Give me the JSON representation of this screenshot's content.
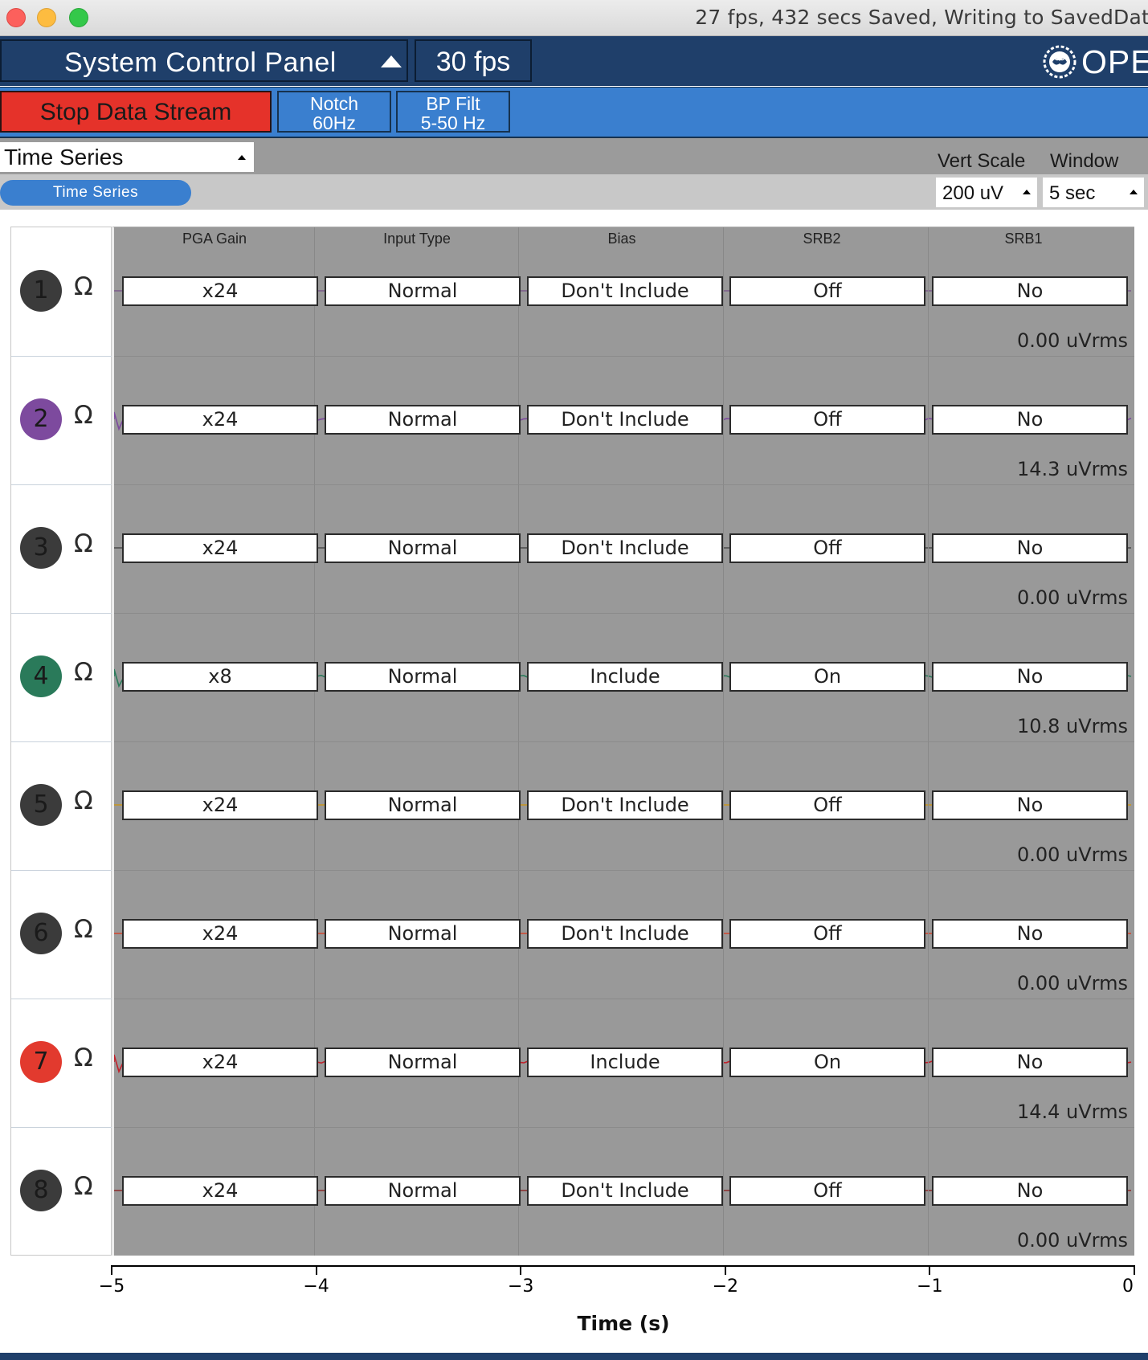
{
  "window": {
    "status_title": "27 fps, 432 secs Saved, Writing to SavedDat"
  },
  "topbar": {
    "system_control_panel": "System Control Panel",
    "fps": "30 fps",
    "logo_text": "OPE"
  },
  "bar2": {
    "stop_stream": "Stop Data Stream",
    "notch_line1": "Notch",
    "notch_line2": "60Hz",
    "bp_line1": "BP Filt",
    "bp_line2": "5-50 Hz"
  },
  "widget": {
    "selected": "Time Series",
    "tab": "Time Series",
    "vert_scale_label": "Vert Scale",
    "window_label": "Window",
    "vert_scale_value": "200 uV",
    "window_value": "5 sec"
  },
  "columns": [
    "PGA Gain",
    "Input Type",
    "Bias",
    "SRB2",
    "SRB1"
  ],
  "channels": [
    {
      "num": "1",
      "color": "#3b3b3b",
      "text_color": "#1a1a1a",
      "settings": [
        "x24",
        "Normal",
        "Don't Include",
        "Off",
        "No"
      ],
      "uvrms": "0.00 uVrms"
    },
    {
      "num": "2",
      "color": "#7d4a9e",
      "text_color": "#1a1a1a",
      "settings": [
        "x24",
        "Normal",
        "Don't Include",
        "Off",
        "No"
      ],
      "uvrms": "14.3 uVrms"
    },
    {
      "num": "3",
      "color": "#3b3b3b",
      "text_color": "#1a1a1a",
      "settings": [
        "x24",
        "Normal",
        "Don't Include",
        "Off",
        "No"
      ],
      "uvrms": "0.00 uVrms"
    },
    {
      "num": "4",
      "color": "#2a7a5a",
      "text_color": "#1a1a1a",
      "settings": [
        "x8",
        "Normal",
        "Include",
        "On",
        "No"
      ],
      "uvrms": "10.8 uVrms"
    },
    {
      "num": "5",
      "color": "#3b3b3b",
      "text_color": "#1a1a1a",
      "settings": [
        "x24",
        "Normal",
        "Don't Include",
        "Off",
        "No"
      ],
      "uvrms": "0.00 uVrms"
    },
    {
      "num": "6",
      "color": "#3b3b3b",
      "text_color": "#1a1a1a",
      "settings": [
        "x24",
        "Normal",
        "Don't Include",
        "Off",
        "No"
      ],
      "uvrms": "0.00 uVrms"
    },
    {
      "num": "7",
      "color": "#e23a2e",
      "text_color": "#1a1a1a",
      "settings": [
        "x24",
        "Normal",
        "Include",
        "On",
        "No"
      ],
      "uvrms": "14.4 uVrms"
    },
    {
      "num": "8",
      "color": "#3b3b3b",
      "text_color": "#1a1a1a",
      "settings": [
        "x24",
        "Normal",
        "Don't Include",
        "Off",
        "No"
      ],
      "uvrms": "0.00 uVrms"
    }
  ],
  "signal_colors": [
    "#7a5a8a",
    "#7d4a9e",
    "#4a4a4a",
    "#2a7a5a",
    "#c8961e",
    "#d2462e",
    "#c0202a",
    "#8a2a2a"
  ],
  "impedance_glyph": "Ω",
  "chart_data": {
    "type": "line",
    "xlabel": "Time (s)",
    "xlim": [
      -5,
      0
    ],
    "x_ticks": [
      "−5",
      "−4",
      "−3",
      "−2",
      "−1",
      "0"
    ]
  }
}
